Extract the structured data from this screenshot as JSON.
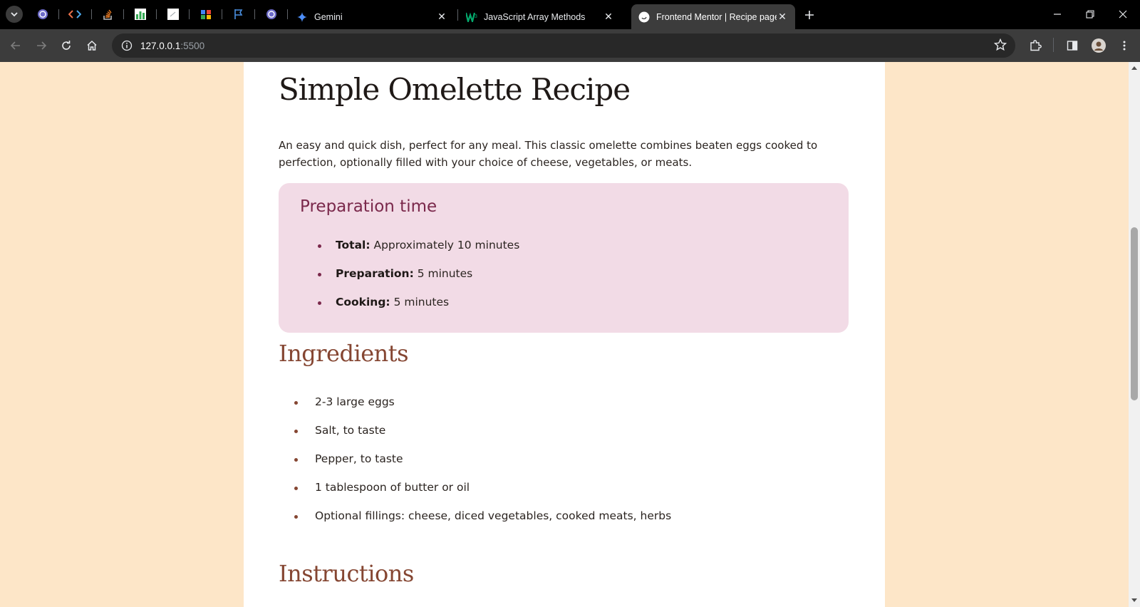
{
  "browser": {
    "tabs": [
      {
        "title": "Gemini",
        "favicon": "gemini-icon"
      },
      {
        "title": "JavaScript Array Methods",
        "favicon": "w3schools-icon"
      },
      {
        "title": "Frontend Mentor | Recipe page",
        "favicon": "frontend-mentor-icon",
        "active": true
      }
    ],
    "pinned_tabs": [
      "chatgpt-icon",
      "code-icon",
      "stackoverflow-icon",
      "chart-icon",
      "document-icon",
      "google-tasks-icon",
      "flag-icon",
      "chatgpt-icon"
    ],
    "url_host": "127.0.0.1",
    "url_port": ":5500"
  },
  "recipe": {
    "title": "Simple Omelette Recipe",
    "intro": "An easy and quick dish, perfect for any meal. This classic omelette combines beaten eggs cooked to perfection, optionally filled with your choice of cheese, vegetables, or meats.",
    "prep": {
      "heading": "Preparation time",
      "items": [
        {
          "label": "Total:",
          "value": "Approximately 10 minutes"
        },
        {
          "label": "Preparation:",
          "value": "5 minutes"
        },
        {
          "label": "Cooking:",
          "value": "5 minutes"
        }
      ]
    },
    "ingredients": {
      "heading": "Ingredients",
      "items": [
        "2-3 large eggs",
        "Salt, to taste",
        "Pepper, to taste",
        "1 tablespoon of butter or oil",
        "Optional fillings: cheese, diced vegetables, cooked meats, herbs"
      ]
    },
    "instructions": {
      "heading": "Instructions"
    }
  },
  "colors": {
    "page_bg": "#fde6c8",
    "card_bg": "#ffffff",
    "prep_bg": "#f2dbe6",
    "prep_accent": "#7a284b",
    "heading_brown": "#854632"
  }
}
